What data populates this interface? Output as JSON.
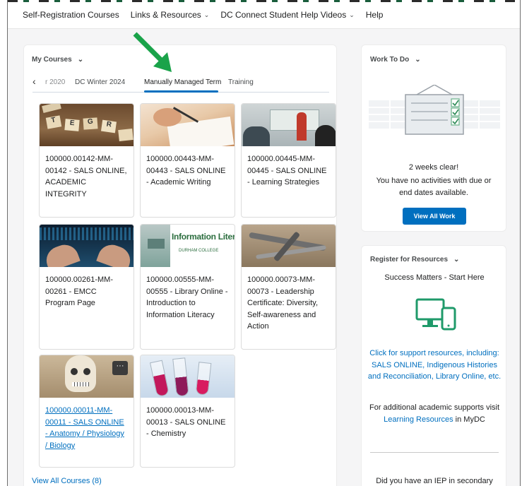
{
  "nav": {
    "items": [
      {
        "label": "Self-Registration Courses",
        "dropdown": false
      },
      {
        "label": "Links & Resources",
        "dropdown": true
      },
      {
        "label": "DC Connect Student Help Videos",
        "dropdown": true
      },
      {
        "label": "Help",
        "dropdown": false
      }
    ]
  },
  "my_courses": {
    "title": "My Courses",
    "tabs": [
      {
        "label": "r 2020"
      },
      {
        "label": "DC Winter 2024"
      },
      {
        "label": "Manually Managed Term",
        "active": true
      },
      {
        "label": "Training"
      }
    ],
    "cards": [
      {
        "code": "100000.00142-MM-00142 - SALS ONLINE, ACADEMIC INTEGRITY",
        "image": "scrabble-tiles"
      },
      {
        "code": "100000.00443-MM-00443 - SALS ONLINE - Academic Writing",
        "image": "writing-hand"
      },
      {
        "code": "100000.00445-MM-00445 - SALS ONLINE - Learning Strategies",
        "image": "classroom"
      },
      {
        "code": "100000.00261-MM-00261 - EMCC Program Page",
        "image": "keyboard-code"
      },
      {
        "code": "100000.00555-MM-00555 - Library Online - Introduction to Information Literacy",
        "image": "information-literacy",
        "image_text": "Information Literacy",
        "image_sub": "DURHAM COLLEGE"
      },
      {
        "code": "100000.00073-MM-00073 - Leadership Certificate: Diversity, Self-awareness and Action",
        "image": "tools"
      },
      {
        "code": "100000.00011-MM-00011 - SALS ONLINE - Anatomy / Physiology / Biology",
        "image": "skeleton",
        "link": true,
        "more_icon": "ellipsis-icon"
      },
      {
        "code": "100000.00013-MM-00013 - SALS ONLINE - Chemistry",
        "image": "test-tubes"
      }
    ],
    "view_all": "View All Courses (8)"
  },
  "work_to_do": {
    "title": "Work To Do",
    "headline": "2 weeks clear!",
    "message": "You have no activities with due or end dates available.",
    "button": "View All Work"
  },
  "register": {
    "title": "Register for Resources",
    "heading": "Success Matters - Start Here",
    "link_text": "Click for support resources, including: SALS ONLINE, Indigenous Histories and Reconciliation, Library Online, etc.",
    "additional_prefix": "For additional academic supports visit ",
    "additional_link": "Learning Resources",
    "additional_suffix": " in MyDC",
    "iep_text": "Did you have an IEP in secondary"
  },
  "colors": {
    "accent": "#006fbf",
    "icon_green": "#1f9a6a",
    "annotation_arrow": "#1aa34a"
  }
}
